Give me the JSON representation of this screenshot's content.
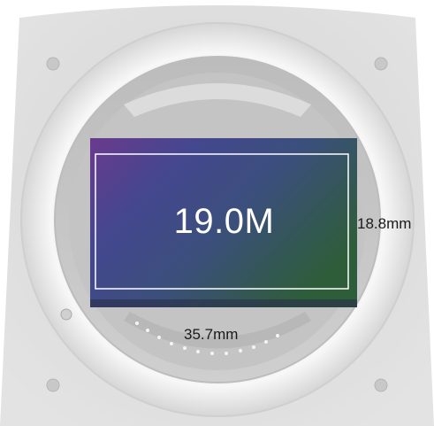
{
  "image": {
    "subject": "camera-lens-mount-with-image-sensor",
    "colors": {
      "body": "#d9d9d9",
      "mount_ring": "#eeeeee",
      "sensor_start": "#5c2f86",
      "sensor_mid": "#3e4c92",
      "sensor_end": "#2f5a3a",
      "outline": "#ffffff"
    }
  },
  "sensor": {
    "resolution_label": "19.0M",
    "height_label": "18.8mm",
    "width_label": "35.7mm"
  }
}
